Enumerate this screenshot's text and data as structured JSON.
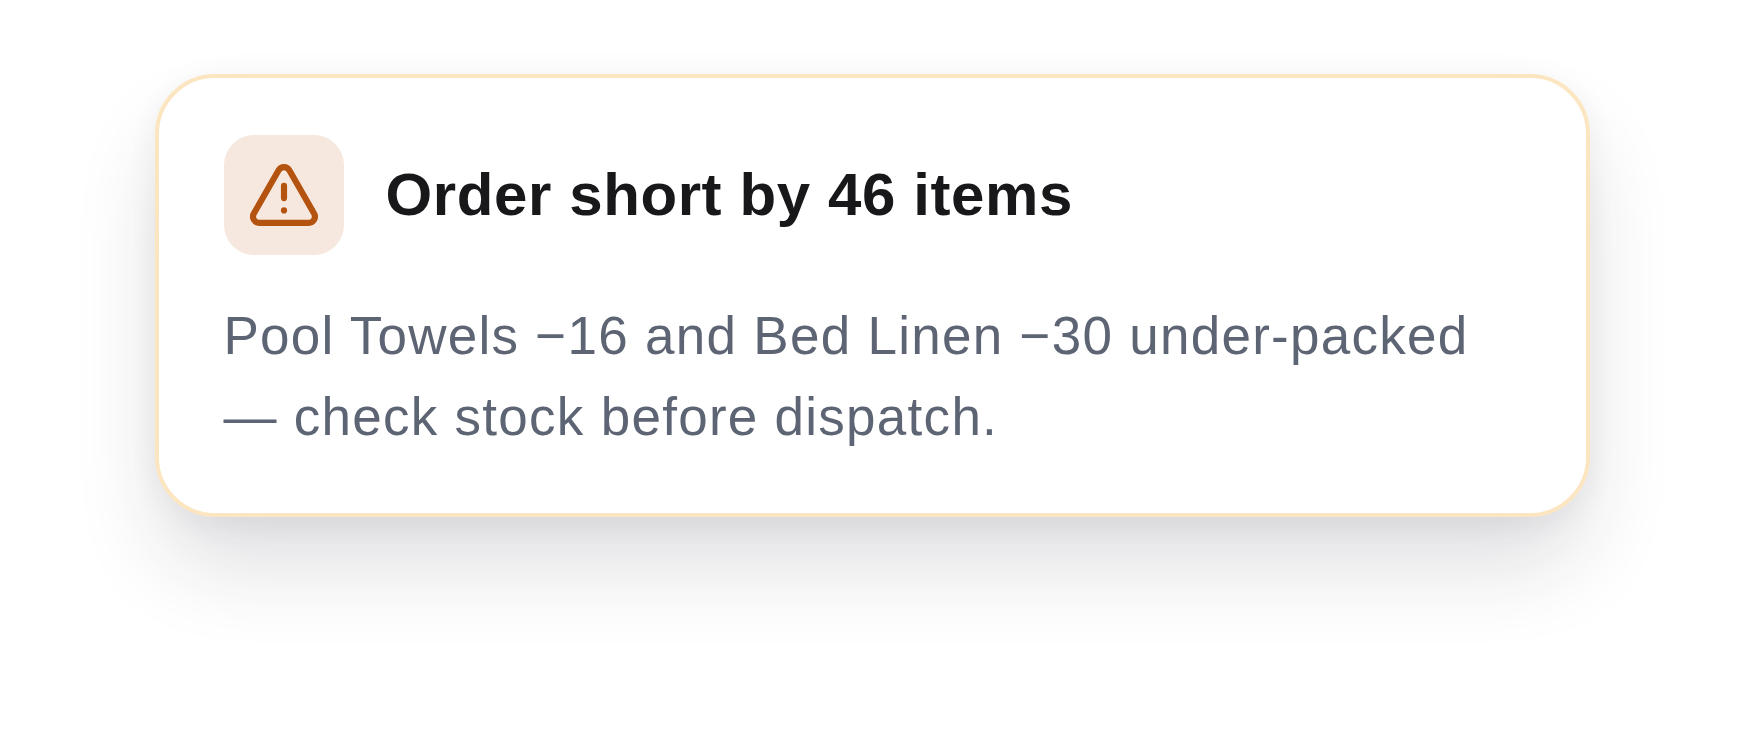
{
  "alert": {
    "kind": "warning",
    "title": "Order short by 46 items",
    "message": "Pool Towels −16 and Bed Linen −30 under-packed — check stock before dispatch."
  }
}
